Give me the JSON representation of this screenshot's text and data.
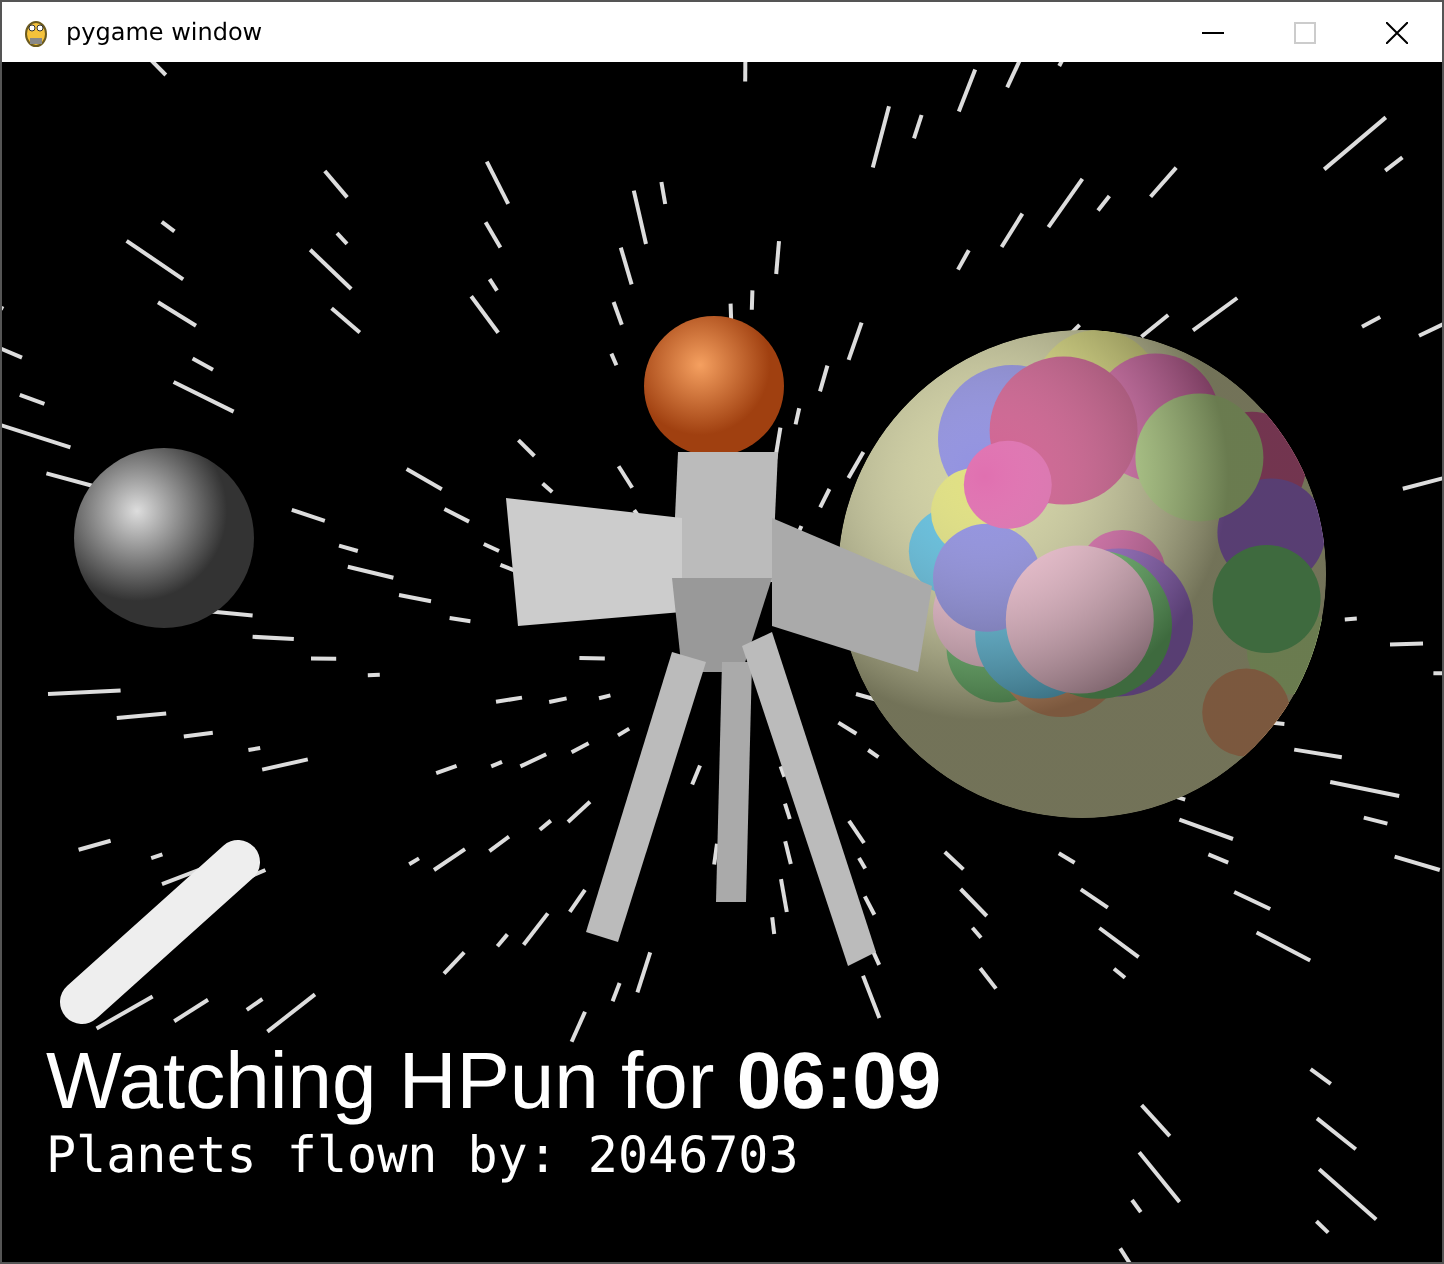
{
  "window": {
    "title": "pygame window"
  },
  "hud": {
    "watching": "Watching HPun for **06:09**",
    "planets_flown": "Planets flown by: 2046703"
  }
}
